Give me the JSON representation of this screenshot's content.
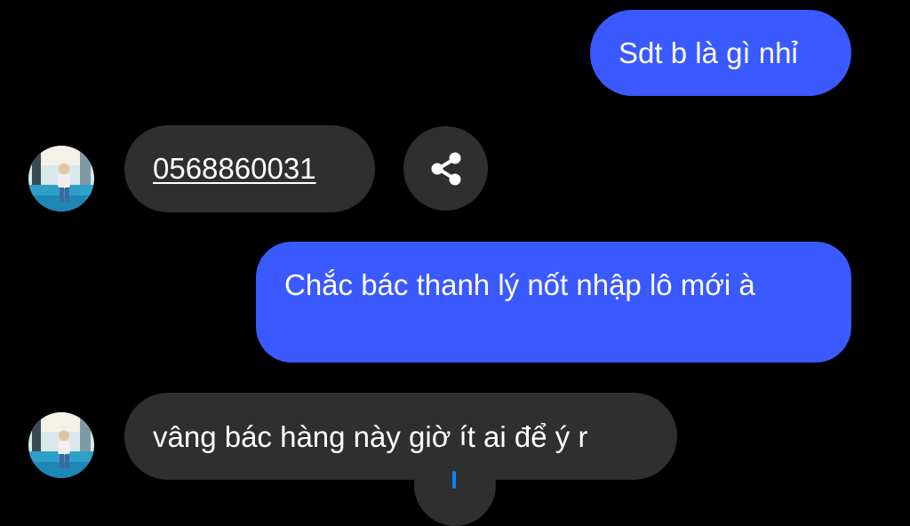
{
  "colors": {
    "background": "#000000",
    "sent_bubble": "#3a59ff",
    "received_bubble": "#2f2f2f",
    "text": "#ffffff",
    "accent": "#0a84ff"
  },
  "messages": [
    {
      "direction": "sent",
      "text": "Sdt b là gì nhỉ"
    },
    {
      "direction": "received",
      "text": "0568860031",
      "is_phone_link": true
    },
    {
      "direction": "sent",
      "text": "Chắc bác thanh lý nốt nhập lô mới à"
    },
    {
      "direction": "received",
      "text": "vâng bác hàng này giờ ít ai để ý r"
    }
  ],
  "icons": {
    "share": "share-icon",
    "scroll_down": "arrow-down-icon",
    "avatar": "avatar-photo"
  }
}
